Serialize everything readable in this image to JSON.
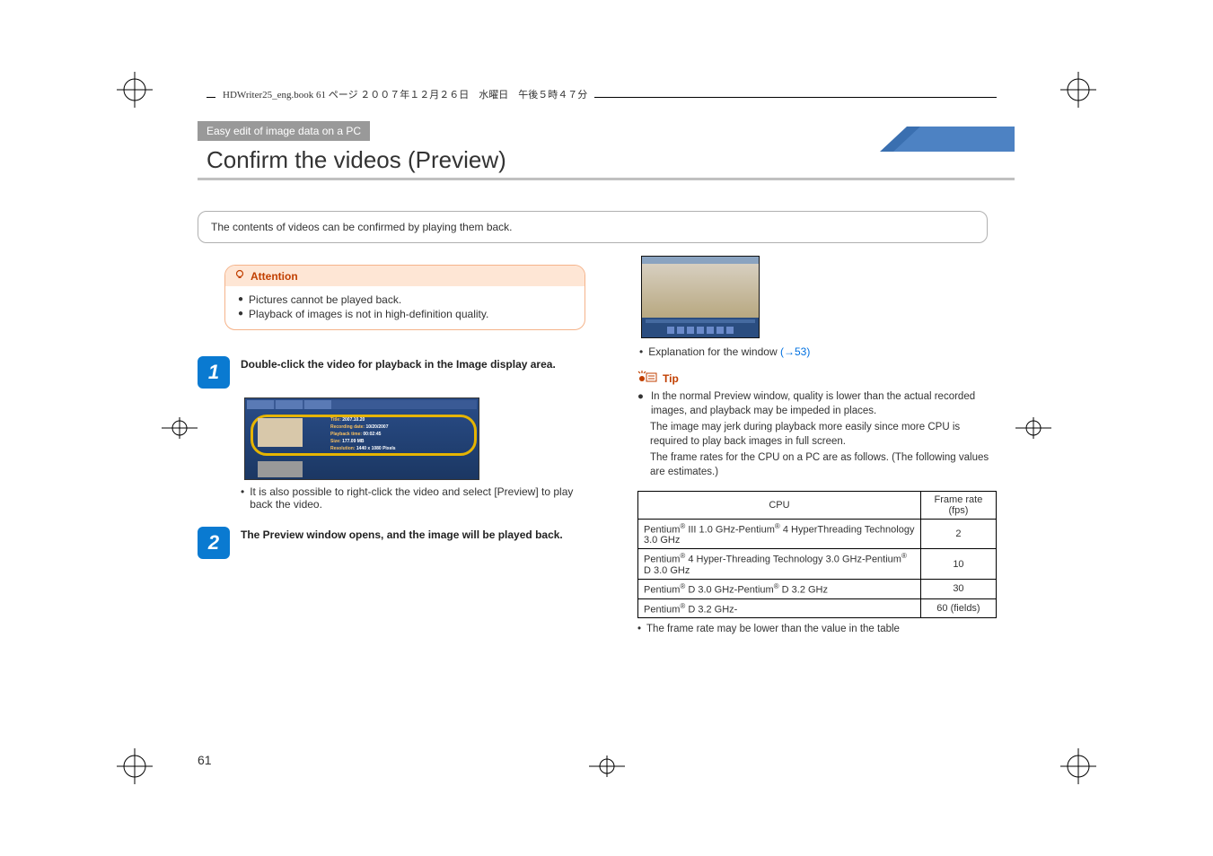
{
  "filebar": "HDWriter25_eng.book  61 ページ  ２００７年１２月２６日　水曜日　午後５時４７分",
  "section": {
    "subtitle": "Easy edit of image data on a PC",
    "title": "Confirm the videos (Preview)"
  },
  "intro": "The contents of videos can be confirmed by playing them back.",
  "attention": {
    "label": "Attention",
    "lines": [
      "Pictures cannot be played back.",
      "Playback of images is not in high-definition quality."
    ]
  },
  "steps": [
    {
      "num": "1",
      "text": "Double-click the video for playback in the Image display area.",
      "thumb_meta": {
        "title": "2007.10.20",
        "recording_date": "10/20/2007",
        "playback_time": "00:02:45",
        "size": "177.09 MB",
        "resolution": "1440 x 1080 Pixels"
      },
      "sub": "It is also possible to right-click the video and select [Preview] to play back the video."
    },
    {
      "num": "2",
      "text": "The Preview window opens, and the image will be played back."
    }
  ],
  "right": {
    "explanation": "Explanation for the window",
    "explanation_link": "(→53)",
    "tip_label": "Tip",
    "tip_main": "In the normal Preview window, quality is lower than the actual recorded images, and playback may be impeded in places.",
    "tip_cont1": "The image may jerk during playback more easily since more CPU is required to play back images in full screen.",
    "tip_cont2": "The frame rates for the CPU on a PC are as follows. (The following values are estimates.)",
    "table": {
      "headers": [
        "CPU",
        "Frame rate (fps)"
      ],
      "rows": [
        {
          "cpu": "Pentium® III 1.0 GHz-Pentium® 4 HyperThreading Technology  3.0 GHz",
          "fr": "2"
        },
        {
          "cpu": "Pentium® 4 Hyper-Threading Technology 3.0 GHz-Pentium® D 3.0 GHz",
          "fr": "10"
        },
        {
          "cpu": "Pentium® D 3.0 GHz-Pentium® D 3.2 GHz",
          "fr": "30"
        },
        {
          "cpu": "Pentium® D 3.2 GHz-",
          "fr": "60 (fields)"
        }
      ]
    },
    "table_note": "The frame rate may be lower than the value in the table"
  },
  "pagenum": "61"
}
